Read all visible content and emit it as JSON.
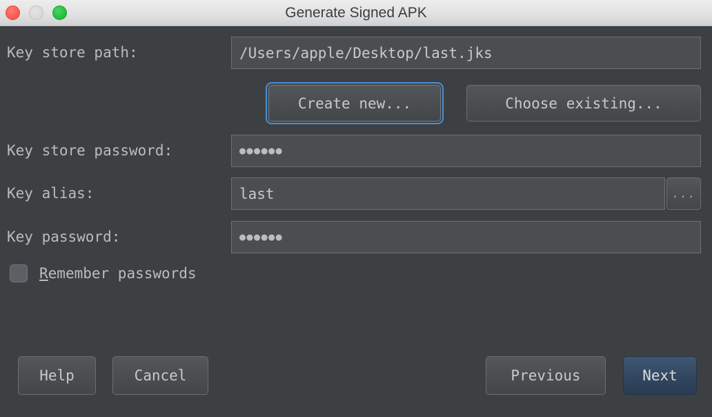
{
  "window": {
    "title": "Generate Signed APK",
    "traffic_lights": [
      {
        "name": "close",
        "color": "#f9584e"
      },
      {
        "name": "minimize",
        "color": "#d8d8d8"
      },
      {
        "name": "maximize",
        "color": "#1fbe3c"
      }
    ]
  },
  "form": {
    "keystore_path": {
      "label": "Key store path:",
      "value": "/Users/apple/Desktop/last.jks"
    },
    "create_new_button": "Create new...",
    "choose_existing_button": "Choose existing...",
    "keystore_password": {
      "label": "Key store password:",
      "value": "●●●●●●"
    },
    "key_alias": {
      "label": "Key alias:",
      "value": "last",
      "browse_button": "..."
    },
    "key_password": {
      "label": "Key password:",
      "value": "●●●●●●"
    },
    "remember_passwords": {
      "label_mnemonic": "R",
      "label_rest": "emember passwords",
      "checked": false
    }
  },
  "footer": {
    "help_button": "Help",
    "cancel_button": "Cancel",
    "previous_button": "Previous",
    "next_button": "Next"
  },
  "colors": {
    "background": "#3c4043",
    "field_background": "#4a4e51",
    "text": "#b9bdc0",
    "focus_ring": "#4a90d9",
    "default_button": "#32465f",
    "titlebar": "#e2e2e2"
  }
}
